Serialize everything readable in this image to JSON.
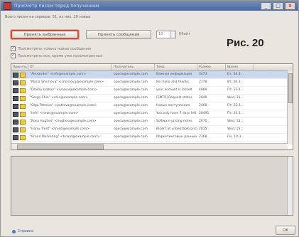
{
  "window": {
    "title": "Просмотр писем перед получением",
    "controls": [
      "_",
      "□",
      "x"
    ]
  },
  "status": {
    "text": "Всего писем на сервере: 51, из них: 20 новых"
  },
  "toolbar": {
    "receive_selected_label": "Принять выбранные",
    "receive_messages_label": "Принять сообщения",
    "limit_value": "10",
    "limit_unit": "Кбайт"
  },
  "figure_label": "Рис. 20",
  "options": [
    {
      "label": "Просмотреть только новые сообщения",
      "checked": true
    },
    {
      "label": "Просмотреть все, кроме уже просмотренных",
      "checked": true
    }
  ],
  "table": {
    "columns": [
      "Принять",
      "От",
      "Получатель",
      "Тема",
      "Размер",
      "Время"
    ],
    "rows": [
      {
        "from": "\"Alexander\" <info@example.com>",
        "to": "opera@example.com",
        "subject": "Важная информация",
        "size": "3473",
        "time": "Вт, 04.3..."
      },
      {
        "from": "\"Maria Smirnova\" <smirnova@example.com>",
        "to": "opera@example.com",
        "subject": "Re: hello and thanks",
        "size": "2178",
        "time": "Вт, 04.3..."
      },
      {
        "from": "\"Dmitry Ivanov\" <ivanov@example.com>",
        "to": "opera@example.com",
        "subject": "your account is locked",
        "size": "4089",
        "time": "Пт, 23.1..."
      },
      {
        "from": "\"Serge Chin\" <chin@example.com>",
        "to": "opera@example.com",
        "subject": "[SMTP] Request status",
        "size": "2849",
        "time": "Wed, 16..."
      },
      {
        "from": "\"Olga Petrova\" <petrova@example.com>",
        "to": "opera@example.com",
        "subject": "Новые поступления",
        "size": "2460",
        "time": "Пт, 23.1..."
      },
      {
        "from": "\"Info\" <news@example.com>",
        "to": "opera@example.com",
        "subject": "You only have 7 days left",
        "size": "28491",
        "time": "Пт, 23.1..."
      },
      {
        "from": "\"Rosa Hughes\" <hughes@example.com>",
        "to": "opera@example.com",
        "subject": "Software pricing notes",
        "size": "2670",
        "time": "Wed, 15..."
      },
      {
        "from": "\"Harry Trent\" <trent@example.com>",
        "to": "opera@example.com",
        "subject": "RIGHT at unbeatable price",
        "size": "2815",
        "time": "Wed, 15..."
      },
      {
        "from": "\"Brand Marketing\" <brand@example.com>",
        "to": "opera@example.com",
        "subject": "Маркетинговые данные",
        "size": "2368",
        "time": "Пн, 10.3..."
      }
    ]
  },
  "footer": {
    "help_label": "Справка",
    "ok_label": "OK"
  },
  "colors": {
    "accent_highlight": "#e0462a",
    "selection": "#c8d8f0",
    "titlebar": "#4a6aa0"
  }
}
